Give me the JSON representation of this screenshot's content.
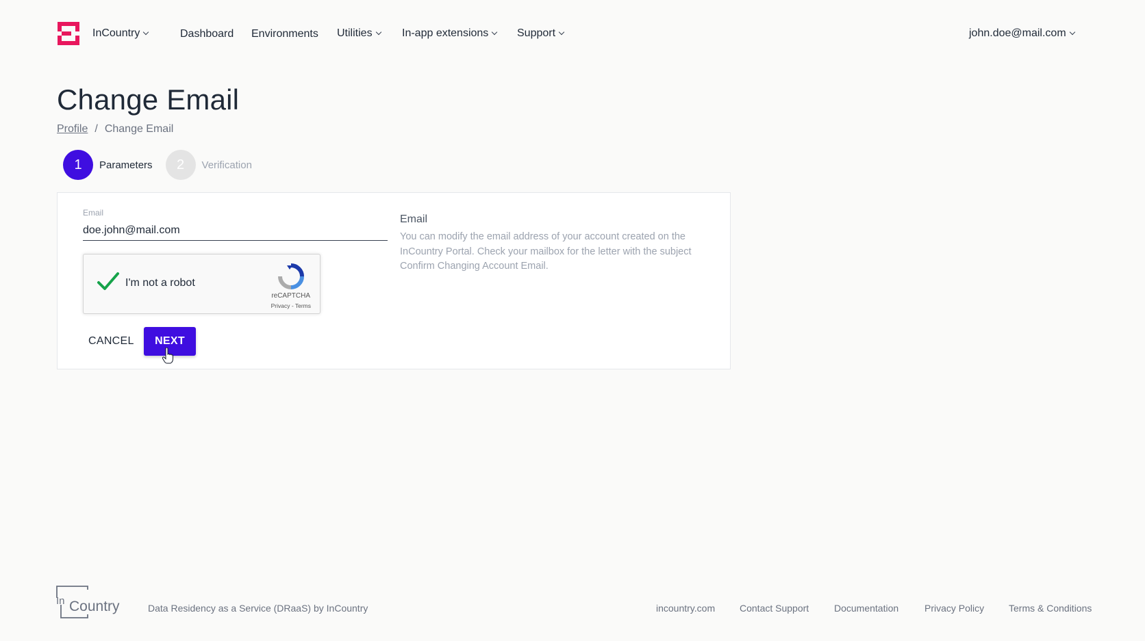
{
  "header": {
    "org_name": "InCountry",
    "nav": {
      "dashboard": "Dashboard",
      "environments": "Environments",
      "utilities": "Utilities",
      "extensions": "In-app extensions",
      "support": "Support"
    },
    "user": "john.doe@mail.com",
    "brand_color": "#e8175d"
  },
  "page": {
    "title": "Change Email",
    "breadcrumb": {
      "parent": "Profile",
      "separator": "/",
      "current": "Change Email"
    }
  },
  "stepper": {
    "steps": [
      {
        "number": "1",
        "label": "Parameters",
        "state": "active"
      },
      {
        "number": "2",
        "label": "Verification",
        "state": "inactive"
      }
    ],
    "active_color": "#3f0ee0"
  },
  "form": {
    "email_label": "Email",
    "email_value": "doe.john@mail.com",
    "recaptcha": {
      "label": "I'm not a robot",
      "brand": "reCAPTCHA",
      "links": "Privacy - Terms",
      "checked": true
    },
    "cancel_label": "CANCEL",
    "next_label": "NEXT"
  },
  "help": {
    "title": "Email",
    "text": "You can modify the email address of your account created on the InCountry Portal. Check your mailbox for the letter with the subject Confirm Changing Account Email."
  },
  "footer": {
    "tagline": "Data Residency as a Service (DRaaS) by InCountry",
    "links": [
      "incountry.com",
      "Contact Support",
      "Documentation",
      "Privacy Policy",
      "Terms & Conditions"
    ]
  }
}
